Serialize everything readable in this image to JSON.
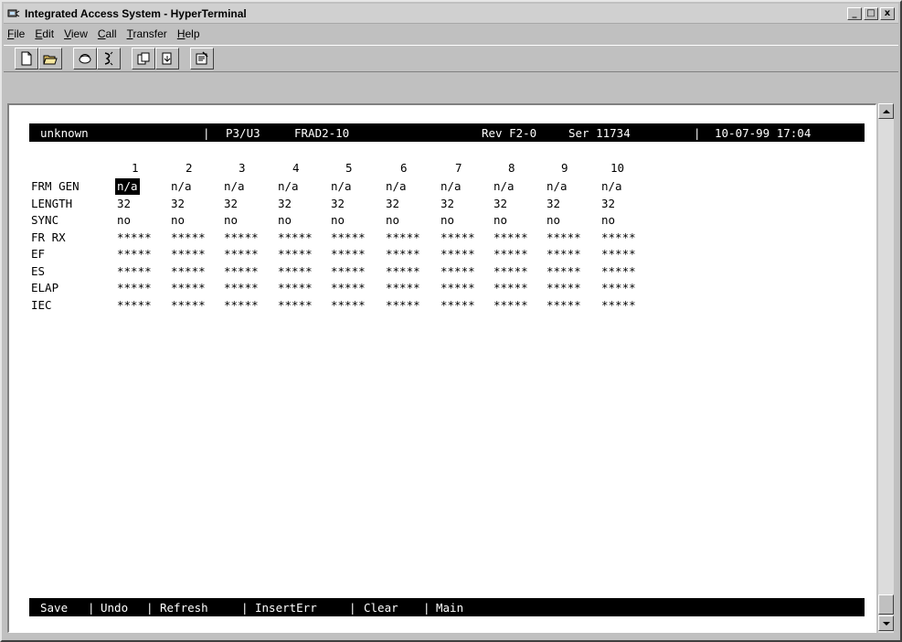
{
  "window": {
    "title": "Integrated Access System - HyperTerminal",
    "minimize": "_",
    "maximize": "□",
    "close": "x"
  },
  "menubar": {
    "items": [
      {
        "acc": "F",
        "rest": "ile"
      },
      {
        "acc": "E",
        "rest": "dit"
      },
      {
        "acc": "V",
        "rest": "iew"
      },
      {
        "acc": "C",
        "rest": "all"
      },
      {
        "acc": "T",
        "rest": "ransfer"
      },
      {
        "acc": "H",
        "rest": "elp"
      }
    ]
  },
  "toolbar": {
    "icons": [
      "new-icon",
      "open-icon",
      "connect-icon",
      "disconnect-icon",
      "send-icon",
      "receive-icon",
      "properties-icon"
    ]
  },
  "terminal": {
    "status": {
      "node": "unknown",
      "sep1": "|",
      "slot": "P3/U3",
      "module": "FRAD2-10",
      "rev": "Rev F2-0",
      "ser": "Ser 11734",
      "sep2": "|",
      "datetime": "10-07-99 17:04"
    },
    "columns": [
      "1",
      "2",
      "3",
      "4",
      "5",
      "6",
      "7",
      "8",
      "9",
      "10"
    ],
    "rows": [
      {
        "label": "FRM GEN",
        "values": [
          "n/a",
          "n/a",
          "n/a",
          "n/a",
          "n/a",
          "n/a",
          "n/a",
          "n/a",
          "n/a",
          "n/a"
        ]
      },
      {
        "label": "LENGTH",
        "values": [
          "32",
          "32",
          "32",
          "32",
          "32",
          "32",
          "32",
          "32",
          "32",
          "32"
        ]
      },
      {
        "label": "SYNC",
        "values": [
          "no",
          "no",
          "no",
          "no",
          "no",
          "no",
          "no",
          "no",
          "no",
          "no"
        ]
      },
      {
        "label": "FR RX",
        "values": [
          "*****",
          "*****",
          "*****",
          "*****",
          "*****",
          "*****",
          "*****",
          "*****",
          "*****",
          "*****"
        ]
      },
      {
        "label": "EF",
        "values": [
          "*****",
          "*****",
          "*****",
          "*****",
          "*****",
          "*****",
          "*****",
          "*****",
          "*****",
          "*****"
        ]
      },
      {
        "label": "ES",
        "values": [
          "*****",
          "*****",
          "*****",
          "*****",
          "*****",
          "*****",
          "*****",
          "*****",
          "*****",
          "*****"
        ]
      },
      {
        "label": "ELAP",
        "values": [
          "*****",
          "*****",
          "*****",
          "*****",
          "*****",
          "*****",
          "*****",
          "*****",
          "*****",
          "*****"
        ]
      },
      {
        "label": "IEC",
        "values": [
          "*****",
          "*****",
          "*****",
          "*****",
          "*****",
          "*****",
          "*****",
          "*****",
          "*****",
          "*****"
        ]
      }
    ],
    "commands": [
      "Save",
      "Undo",
      "Refresh",
      "InsertErr",
      "Clear",
      "Main"
    ],
    "command_sep": "|"
  },
  "colors": {
    "window_bg": "#c0c0c0",
    "terminal_bg": "#ffffff",
    "bar_bg": "#000000",
    "bar_fg": "#ffffff"
  }
}
